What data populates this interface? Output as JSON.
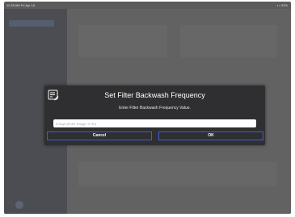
{
  "status_bar": {
    "time": "11:28 AM  Fri Apr 16",
    "indicators": "▪ ▪ 32%"
  },
  "dialog": {
    "icon": "edit-note-icon",
    "title": "Set Filter Backwash Frequency",
    "message": "Enter Filter Backwash Frequency Value.",
    "input": {
      "value": "",
      "placeholder": "# Days (Enter Range: 0~30)"
    },
    "cancel_label": "Cancel",
    "ok_label": "OK"
  },
  "colors": {
    "backdrop": "#5b5b5b",
    "dialog_bg": "#2f2f31",
    "button_border": "#3e5bd9",
    "text": "#ffffff"
  }
}
